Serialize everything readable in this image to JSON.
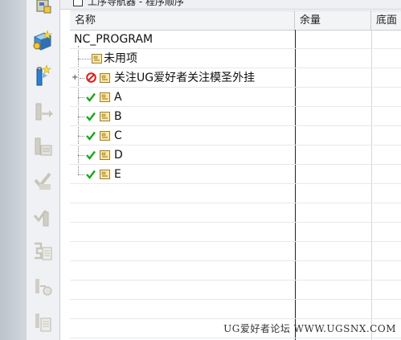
{
  "navigator": {
    "title_fragment": "工序导航器 - 程序顺序",
    "columns": [
      {
        "label": "名称"
      },
      {
        "label": "余量"
      },
      {
        "label": "底面"
      }
    ],
    "rows": [
      {
        "name": "NC_PROGRAM",
        "status": "none",
        "level": 0
      },
      {
        "name": "未用项",
        "status": "none",
        "level": 1
      },
      {
        "name": "关注UG爱好者关注模圣外挂",
        "status": "forbidden",
        "level": 1,
        "expander": "+"
      },
      {
        "name": "A",
        "status": "ok",
        "level": 1
      },
      {
        "name": "B",
        "status": "ok",
        "level": 1
      },
      {
        "name": "C",
        "status": "ok",
        "level": 1
      },
      {
        "name": "D",
        "status": "ok",
        "level": 1
      },
      {
        "name": "E",
        "status": "ok",
        "level": 1
      }
    ]
  },
  "toolbar": {
    "icons": [
      "program-order-icon",
      "geometry-view-icon",
      "machine-tool-view-icon",
      "generate-toolpath-icon",
      "replay-toolpath-icon",
      "verify-toolpath-icon",
      "list-toolpath-icon",
      "postprocess-icon",
      "shop-doc-icon",
      "output-clsf-icon",
      "batch-process-icon"
    ]
  },
  "watermark": "UG爱好者论坛 WWW.UGSNX.COM",
  "colors": {
    "check": "#1aa51a",
    "forbid": "#d81e1e",
    "folder": "#e8b93a"
  }
}
